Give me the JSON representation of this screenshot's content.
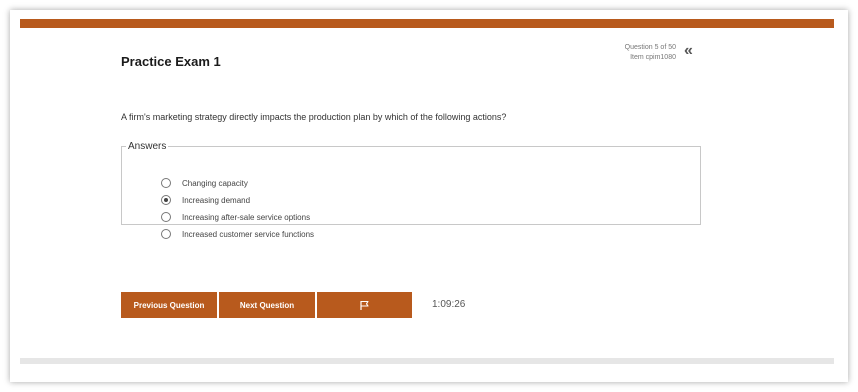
{
  "exam": {
    "title": "Practice Exam 1",
    "question_counter": "Question 5 of 50",
    "item_id": "Item cpim1080",
    "collapse_glyph": "«"
  },
  "question": {
    "text": "A firm's marketing strategy directly impacts the production plan by which of the following actions?"
  },
  "answers": {
    "legend": "Answers",
    "options": [
      {
        "label": "Changing capacity",
        "selected": false
      },
      {
        "label": "Increasing demand",
        "selected": true
      },
      {
        "label": "Increasing after-sale service options",
        "selected": false
      },
      {
        "label": "Increased customer service functions",
        "selected": false
      }
    ]
  },
  "nav": {
    "previous_label": "Previous Question",
    "next_label": "Next Question",
    "flag_icon": "flag-icon"
  },
  "timer": "1:09:26",
  "colors": {
    "accent": "#b85a1d",
    "footer_bar": "#e6e6e6"
  }
}
